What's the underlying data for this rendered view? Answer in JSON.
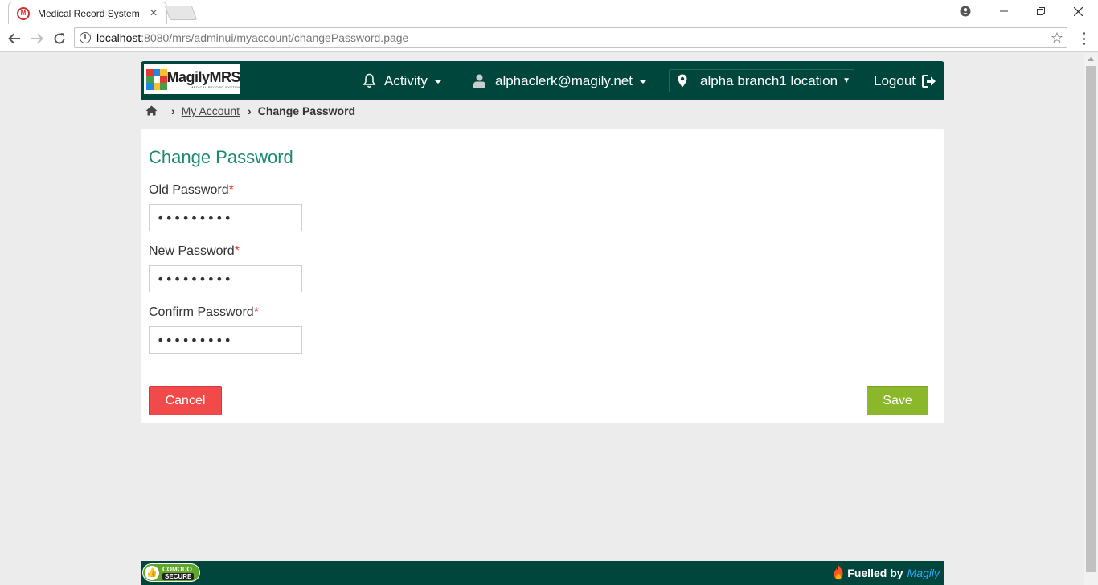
{
  "browser": {
    "tab_title": "Medical Record System",
    "favicon_text": "M",
    "url_host": "localhost",
    "url_path": ":8080/mrs/adminui/myaccount/changePassword.page"
  },
  "header": {
    "logo_text": "MagilyMRS",
    "logo_subtext": "MEDICAL RECORD SYSTEM",
    "activity_label": "Activity",
    "user_label": "alphaclerk@magily.net",
    "location_label": "alpha branch1 location",
    "logout_label": "Logout"
  },
  "breadcrumb": {
    "my_account": "My Account ",
    "current": "Change Password"
  },
  "form": {
    "title": "Change Password",
    "old_password_label": "Old Password",
    "new_password_label": "New Password",
    "confirm_password_label": "Confirm Password",
    "required_mark": "*",
    "old_password_value": "•••••••••",
    "new_password_value": "•••••••••",
    "confirm_password_value": "•••••••••",
    "cancel_label": "Cancel",
    "save_label": "Save"
  },
  "footer": {
    "badge_line1": "COMODO",
    "badge_line2": "SECURE",
    "fuelled_by": "Fuelled by",
    "brand": "Magily"
  },
  "colors": {
    "header_bg": "#00463c",
    "title_green": "#1b8a73",
    "cancel_red": "#f04a4a",
    "save_green": "#8ab82a",
    "required_red": "#e53935"
  }
}
